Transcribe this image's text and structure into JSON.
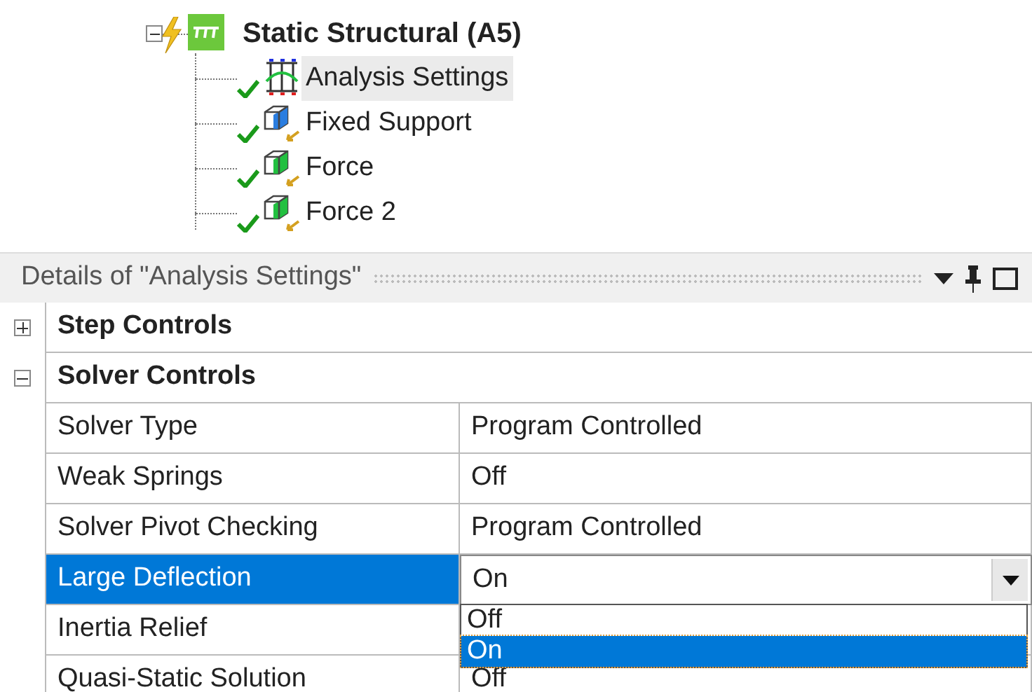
{
  "tree": {
    "label": "Static Structural (A5)",
    "expanded": true,
    "children": [
      {
        "label": "Analysis Settings",
        "kind": "settings",
        "selected": true
      },
      {
        "label": "Fixed Support",
        "kind": "support",
        "selected": false
      },
      {
        "label": "Force",
        "kind": "force",
        "selected": false
      },
      {
        "label": "Force 2",
        "kind": "force",
        "selected": false
      }
    ]
  },
  "details": {
    "title": "Details of \"Analysis Settings\"",
    "sections": [
      {
        "label": "Step Controls",
        "expanded": false
      },
      {
        "label": "Solver Controls",
        "expanded": true,
        "rows": [
          {
            "name": "Solver Type",
            "value": "Program Controlled",
            "selected": false
          },
          {
            "name": "Weak Springs",
            "value": "Off",
            "selected": false
          },
          {
            "name": "Solver Pivot Checking",
            "value": "Program Controlled",
            "selected": false
          },
          {
            "name": "Large Deflection",
            "value": "On",
            "selected": true,
            "kind": "dropdown",
            "options": [
              {
                "label": "Off",
                "selected": false
              },
              {
                "label": "On",
                "selected": true
              }
            ]
          },
          {
            "name": "Inertia Relief",
            "selected": false
          },
          {
            "name": "Quasi-Static Solution",
            "value": "Off",
            "selected": false
          }
        ]
      }
    ]
  }
}
